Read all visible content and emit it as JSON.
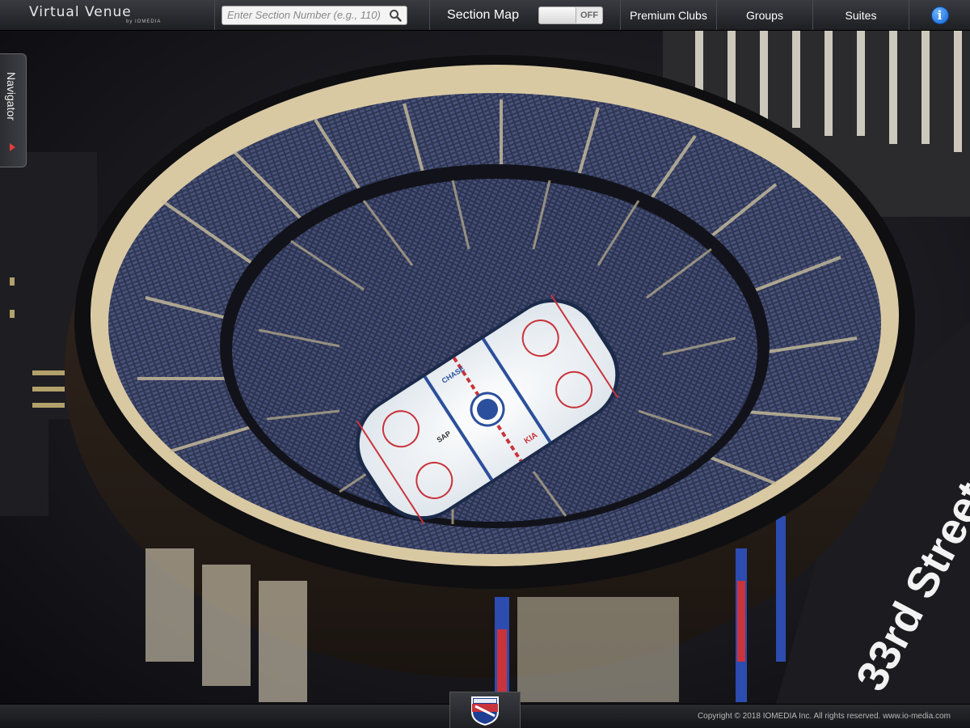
{
  "app": {
    "logo_title": "Virtual Venue",
    "logo_sub": "by IOMEDIA"
  },
  "search": {
    "placeholder": "Enter Section Number (e.g., 110)",
    "value": ""
  },
  "section_map": {
    "label": "Section Map",
    "toggle_state": "OFF"
  },
  "nav": {
    "premium_clubs": "Premium Clubs",
    "groups": "Groups",
    "suites": "Suites"
  },
  "navigator": {
    "label": "Navigator"
  },
  "scene": {
    "street_sign": "33rd Street",
    "rink_ad_left": "CHASE",
    "rink_ad_right": "KIA",
    "rink_ad_mid": "SAP"
  },
  "footer": {
    "copyright": "Copyright © 2018 IOMEDIA Inc. All rights reserved. www.io-media.com"
  },
  "colors": {
    "seat_blue": "#3d4666",
    "concourse_cream": "#d9c9a3",
    "ice_white": "#f3f6f8",
    "rink_red": "#c9333b",
    "rink_blue": "#2b4f9c",
    "accent_blue": "#1166d6"
  },
  "icons": [
    "search-icon",
    "info-icon",
    "navigator-arrow-icon",
    "rangers-logo-icon"
  ]
}
